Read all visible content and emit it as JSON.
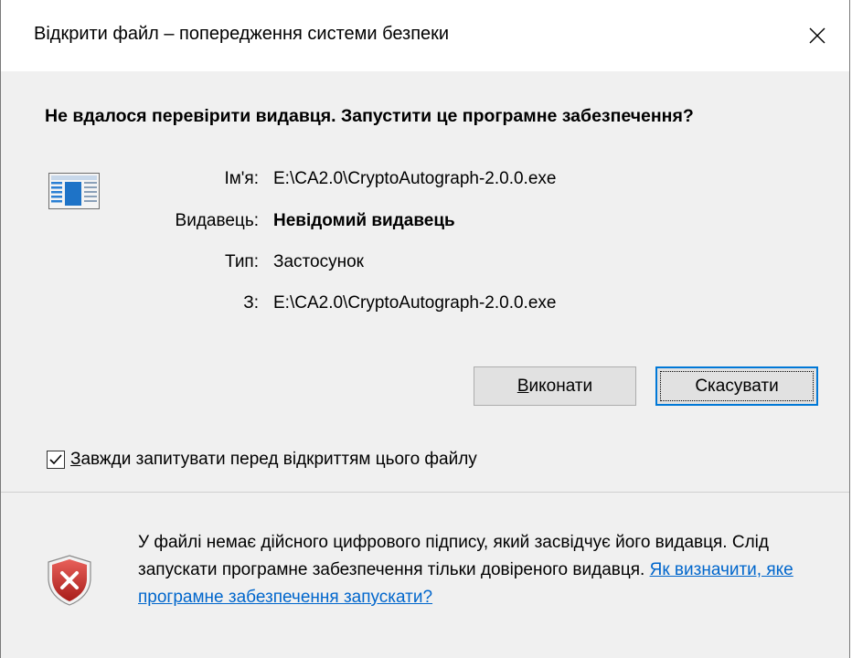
{
  "window": {
    "title": "Відкрити файл – попередження системи безпеки",
    "close_glyph": "✕"
  },
  "headline": "Не вдалося перевірити видавця.  Запустити це програмне забезпечення?",
  "details": {
    "name_label": "Ім'я:",
    "name_value": "E:\\CA2.0\\CryptoAutograph-2.0.0.exe",
    "publisher_label": "Видавець:",
    "publisher_value": "Невідомий видавець",
    "type_label": "Тип:",
    "type_value": "Застосунок",
    "from_label": "З:",
    "from_value": "E:\\CA2.0\\CryptoAutograph-2.0.0.exe"
  },
  "buttons": {
    "run_accel": "В",
    "run_rest": "иконати",
    "cancel_label": "Скасувати"
  },
  "checkbox": {
    "checked": true,
    "accel": "З",
    "rest": "авжди запитувати перед відкриттям цього файлу"
  },
  "footer": {
    "warning_text": "У файлі немає дійсного цифрового підпису, який засвідчує його видавця.  Слід запускати програмне забезпечення тільки довіреного видавця.  ",
    "link_text": "Як визначити, яке програмне забезпечення запускати?"
  },
  "icons": {
    "app": "application-icon",
    "warning": "shield-error-icon",
    "close": "close-icon",
    "check": "checkmark-icon"
  },
  "colors": {
    "link": "#0066cc",
    "focus_border": "#0078d7",
    "panel_bg": "#f0f0f0",
    "shield_red": "#c9302c"
  }
}
